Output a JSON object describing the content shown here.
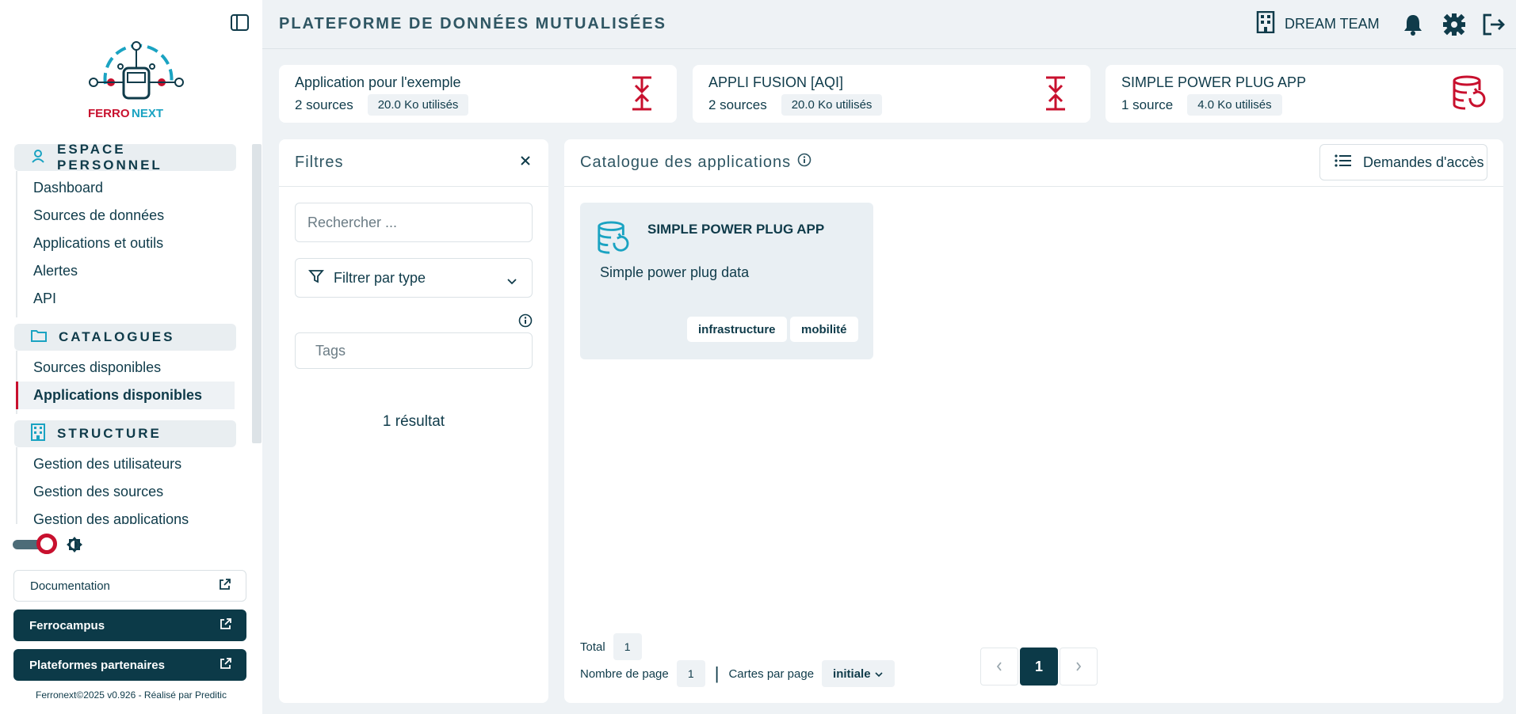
{
  "header": {
    "title": "PLATEFORME DE DONNÉES MUTUALISÉES",
    "team_name": "DREAM TEAM"
  },
  "logo": {
    "text_left": "FERRO",
    "text_right": "NEXT"
  },
  "sidebar": {
    "sections": [
      {
        "label": "ESPACE PERSONNEL",
        "icon": "user-icon",
        "items": [
          "Dashboard",
          "Sources de données",
          "Applications et outils",
          "Alertes",
          "API"
        ]
      },
      {
        "label": "CATALOGUES",
        "icon": "folder-icon",
        "items": [
          "Sources disponibles",
          "Applications disponibles"
        ]
      },
      {
        "label": "STRUCTURE",
        "icon": "building-icon",
        "items": [
          "Gestion des utilisateurs",
          "Gestion des sources",
          "Gestion des applications"
        ]
      }
    ],
    "active_item": "Applications disponibles",
    "documentation_label": "Documentation",
    "ferrocampus_label": "Ferrocampus",
    "partners_label": "Plateformes partenaires",
    "footer": "Ferronext©2025 v0.926 - Réalisé par Preditic"
  },
  "usage_cards": [
    {
      "title": "Application pour l'exemple",
      "sources": "2 sources",
      "usage": "20.0 Ko utilisés",
      "icon": "transfer-icon"
    },
    {
      "title": "APPLI FUSION [AQI]",
      "sources": "2 sources",
      "usage": "20.0 Ko utilisés",
      "icon": "transfer-icon"
    },
    {
      "title": "SIMPLE POWER PLUG APP",
      "sources": "1 source",
      "usage": "4.0 Ko utilisés",
      "icon": "database-refresh-icon"
    }
  ],
  "filters": {
    "title": "Filtres",
    "search_placeholder": "Rechercher ...",
    "type_label": "Filtrer par type",
    "tags_placeholder": "Tags",
    "result_text": "1 résultat"
  },
  "catalogue": {
    "title": "Catalogue des applications",
    "access_button": "Demandes d'accès",
    "apps": [
      {
        "title": "SIMPLE POWER PLUG APP",
        "description": "Simple power plug data",
        "tags": [
          "infrastructure",
          "mobilité"
        ]
      }
    ],
    "total_label": "Total",
    "total_value": "1",
    "page_count_label": "Nombre de page",
    "page_count_value": "1",
    "separator": "|",
    "per_page_label": "Cartes par page",
    "per_page_value": "initiale",
    "current_page": "1"
  },
  "colors": {
    "accent_red": "#c8102e",
    "dark_teal": "#0c3a48",
    "cyan": "#1aa3c2"
  }
}
